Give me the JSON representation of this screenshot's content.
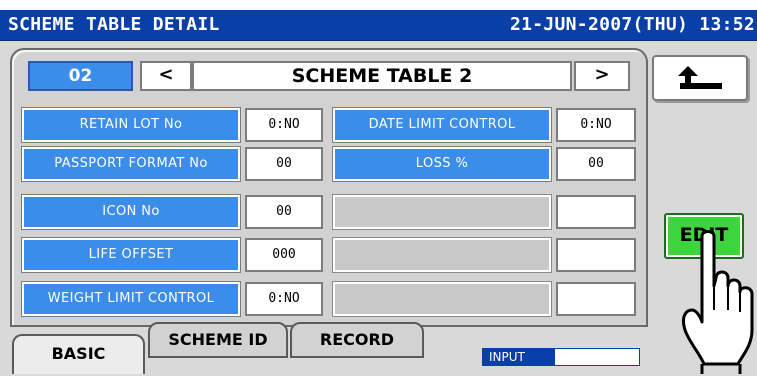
{
  "header": {
    "title": "SCHEME TABLE DETAIL",
    "datetime": "21-JUN-2007(THU) 13:52"
  },
  "scheme": {
    "number": "02",
    "prev_label": "<",
    "name": "SCHEME TABLE 2",
    "next_label": ">"
  },
  "rows_left": [
    {
      "label": "RETAIN LOT No",
      "value": "0:NO"
    },
    {
      "label": "PASSPORT FORMAT No",
      "value": "00"
    },
    {
      "label": "ICON No",
      "value": "00"
    },
    {
      "label": "LIFE OFFSET",
      "value": "000"
    },
    {
      "label": "WEIGHT LIMIT CONTROL",
      "value": "0:NO"
    }
  ],
  "rows_right": [
    {
      "label": "DATE LIMIT CONTROL",
      "value": "0:NO"
    },
    {
      "label": "LOSS %",
      "value": "00"
    },
    {
      "label": "",
      "value": ""
    },
    {
      "label": "",
      "value": ""
    },
    {
      "label": "",
      "value": ""
    }
  ],
  "buttons": {
    "edit_label": "EDIT",
    "back_icon": "return-arrow-icon",
    "hand_icon": "pointing-hand-icon"
  },
  "tabs": [
    {
      "label": "BASIC",
      "active": true
    },
    {
      "label": "SCHEME ID",
      "active": false
    },
    {
      "label": "RECORD",
      "active": false
    }
  ],
  "status": {
    "input_label": "INPUT"
  },
  "colors": {
    "titlebar": "#0b3fa8",
    "label_blue": "#3b8de9",
    "edit_green": "#3ed43e",
    "panel_gray": "#d2d2d2"
  }
}
